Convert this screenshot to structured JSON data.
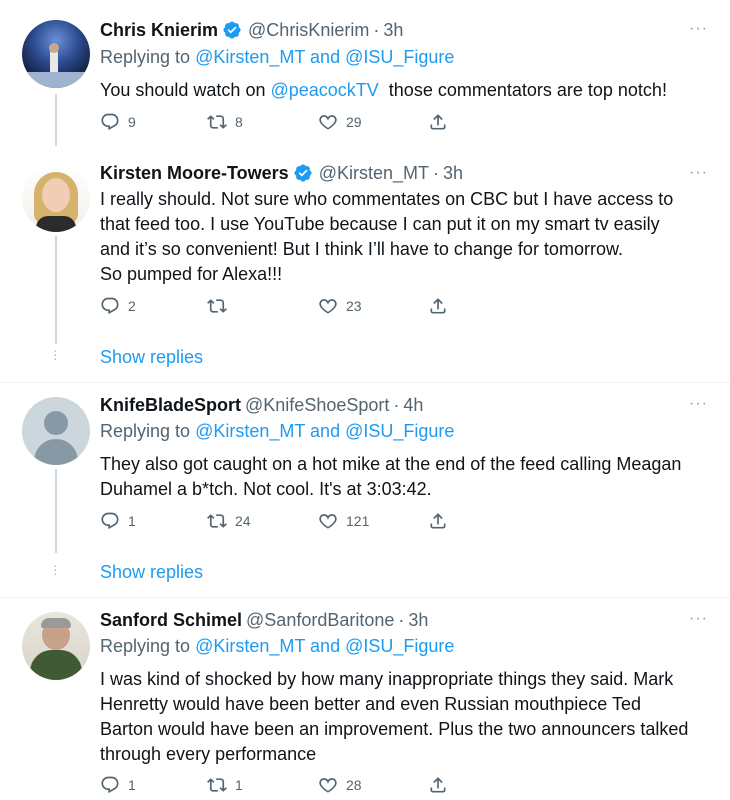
{
  "tweets": [
    {
      "name": "Chris Knierim",
      "verified": true,
      "handle": "@ChrisKnierim",
      "time": "3h",
      "reply_prefix": "Replying to",
      "reply_users": "@Kirsten_MT and @ISU_Figure",
      "body_pre": "You should watch on ",
      "body_link": "@peacockTV",
      "body_post": "  those commentators are top notch!",
      "replies": "9",
      "retweets": "8",
      "likes": "29",
      "more": "···"
    },
    {
      "name": "Kirsten Moore-Towers",
      "verified": true,
      "handle": "@Kirsten_MT",
      "time": "3h",
      "body_lines": [
        "I really should. Not sure who commentates on CBC but I have access to",
        "that feed too. I use YouTube because I can put it on my smart tv easily",
        "and it’s so convenient! But I think I’ll have to change for tomorrow.",
        "So pumped for Alexa!!!"
      ],
      "replies": "2",
      "retweets": "",
      "likes": "23",
      "more": "···",
      "show_replies": "Show replies"
    },
    {
      "name": "KnifeBladeSport",
      "verified": false,
      "handle": "@KnifeShoeSport",
      "time": "4h",
      "reply_prefix": "Replying to",
      "reply_users": "@Kirsten_MT and @ISU_Figure",
      "body_lines": [
        "They also got caught on a hot mike at the end of the feed calling Meagan",
        "Duhamel a b*tch. Not cool. It's at 3:03:42."
      ],
      "replies": "1",
      "retweets": "24",
      "likes": "121",
      "more": "···",
      "show_replies": "Show replies"
    },
    {
      "name": "Sanford Schimel",
      "verified": false,
      "handle": "@SanfordBaritone",
      "time": "3h",
      "reply_prefix": "Replying to",
      "reply_users": "@Kirsten_MT and @ISU_Figure",
      "body_lines": [
        "I was kind of shocked by how many inappropriate things they said. Mark",
        "Henretty would have been better and even Russian mouthpiece Ted",
        "Barton would have been an improvement. Plus the two announcers talked",
        "through every performance"
      ],
      "replies": "1",
      "retweets": "1",
      "likes": "28",
      "more": "···"
    }
  ],
  "icons": [
    "reply-icon",
    "retweet-icon",
    "like-icon",
    "share-icon",
    "verified-icon",
    "more-icon"
  ],
  "colors": {
    "link": "#1d9bf0",
    "secondary": "#536471",
    "verified": "#1d9bf0",
    "text": "#0f1419"
  }
}
